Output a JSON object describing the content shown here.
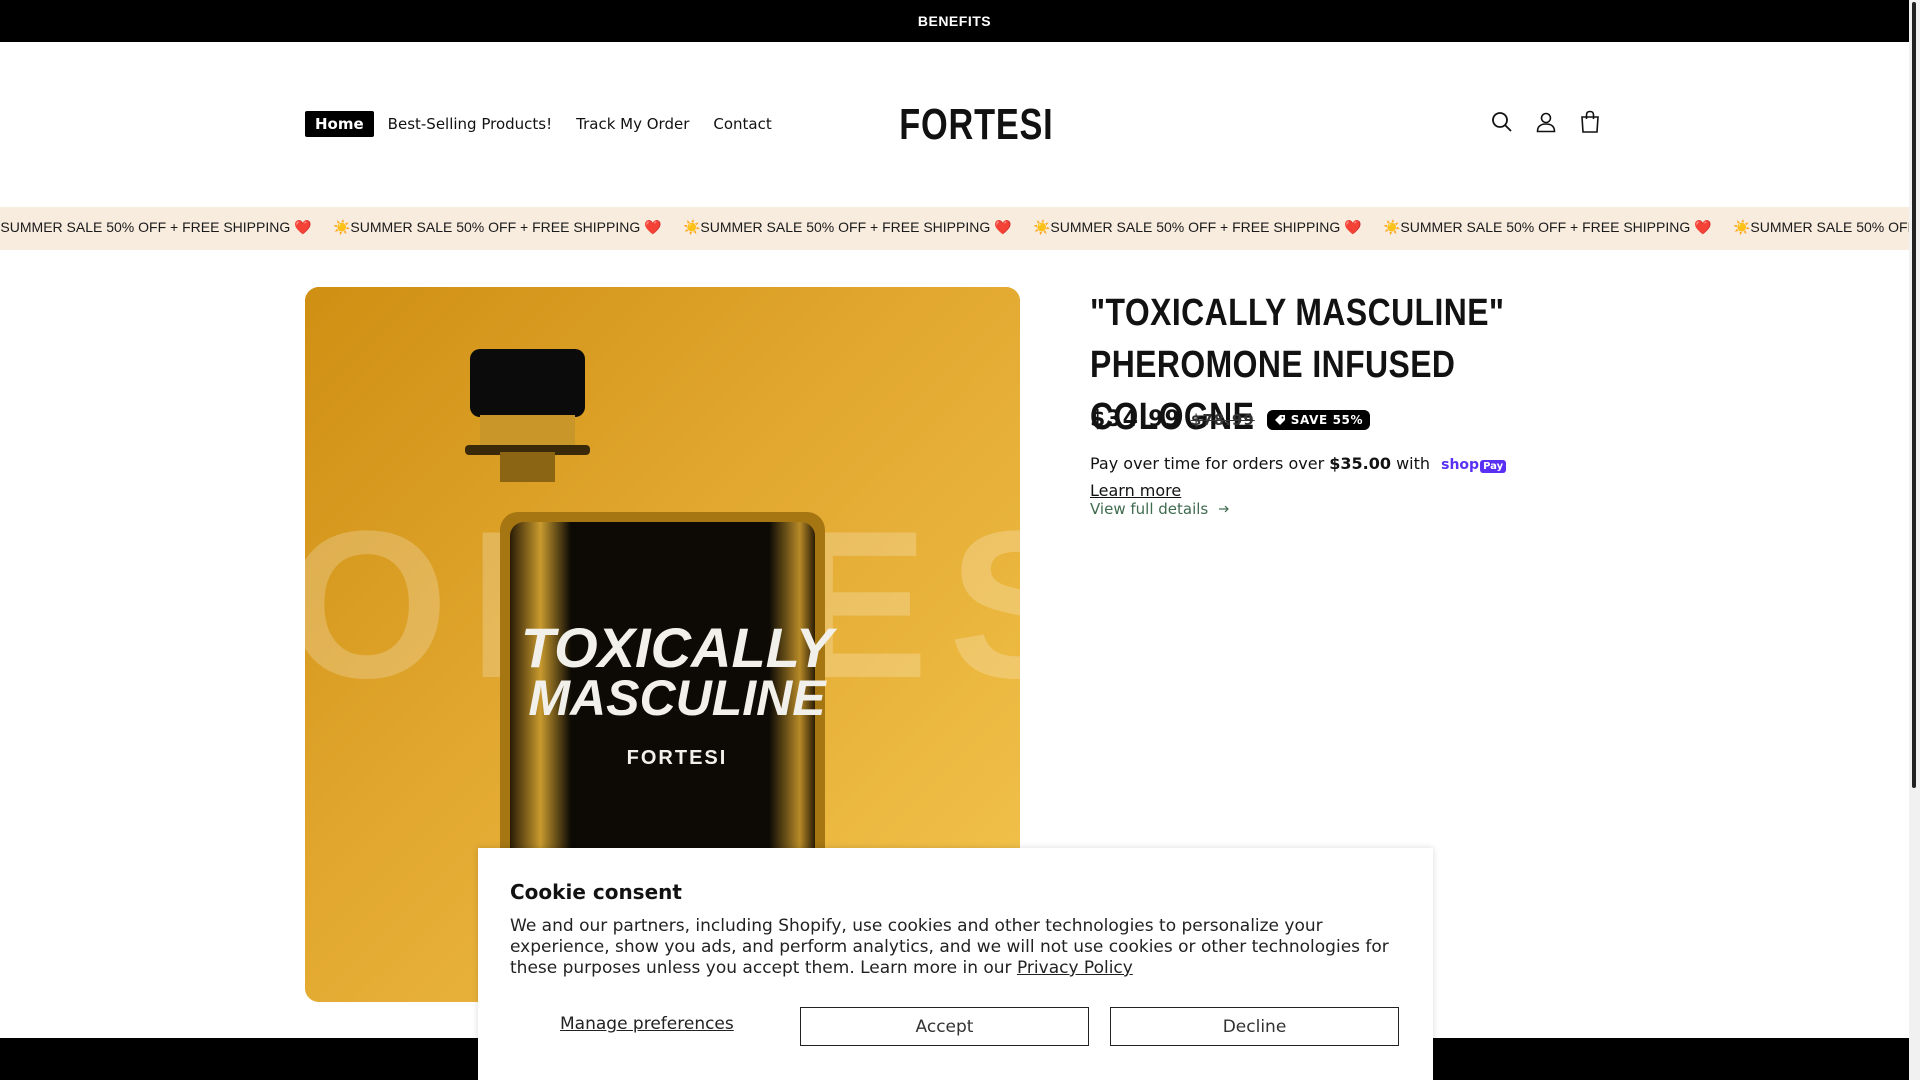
{
  "announcement": "BENEFITS",
  "nav": {
    "items": [
      {
        "label": "Home",
        "active": true
      },
      {
        "label": "Best-Selling Products!",
        "active": false
      },
      {
        "label": "Track My Order",
        "active": false
      },
      {
        "label": "Contact",
        "active": false
      }
    ]
  },
  "logo": "FORTESI",
  "header_icons": [
    "search-icon",
    "account-icon",
    "cart-icon"
  ],
  "marquee": {
    "text": "☀️SUMMER SALE 50% OFF + FREE SHIPPING ❤️",
    "repeat": 7
  },
  "product": {
    "title": "\"TOXICALLY MASCULINE\" PHEROMONE INFUSED COLOGNE",
    "image_text": {
      "background_word": "FORTESI",
      "label_line1": "TOXICALLY",
      "label_line2": "MASCULINE",
      "brand": "FORTESI"
    },
    "price_sale": "$34.99",
    "price_regular": "$78.99",
    "badge": "SAVE 55%",
    "installments": {
      "prefix": "Pay over time for orders over ",
      "amount": "$35.00",
      "middle": " with ",
      "brand": "shop",
      "brand_pay": "Pay",
      "learn_more": "Learn more"
    },
    "view_details": "View full details"
  },
  "cookie": {
    "title": "Cookie consent",
    "body": "We and our partners, including Shopify, use cookies and other technologies to personalize your experience, show you ads, and perform analytics, and we will not use cookies or other technologies for these purposes unless you accept them. Learn more in our ",
    "policy_link": "Privacy Policy",
    "manage": "Manage preferences",
    "accept": "Accept",
    "decline": "Decline"
  },
  "colors": {
    "accent_black": "#000000",
    "marquee_bg": "#f8ecdf",
    "image_gold": "#e7b039",
    "link_green": "#3f6b4f",
    "shoppay_purple": "#5a31f4"
  }
}
